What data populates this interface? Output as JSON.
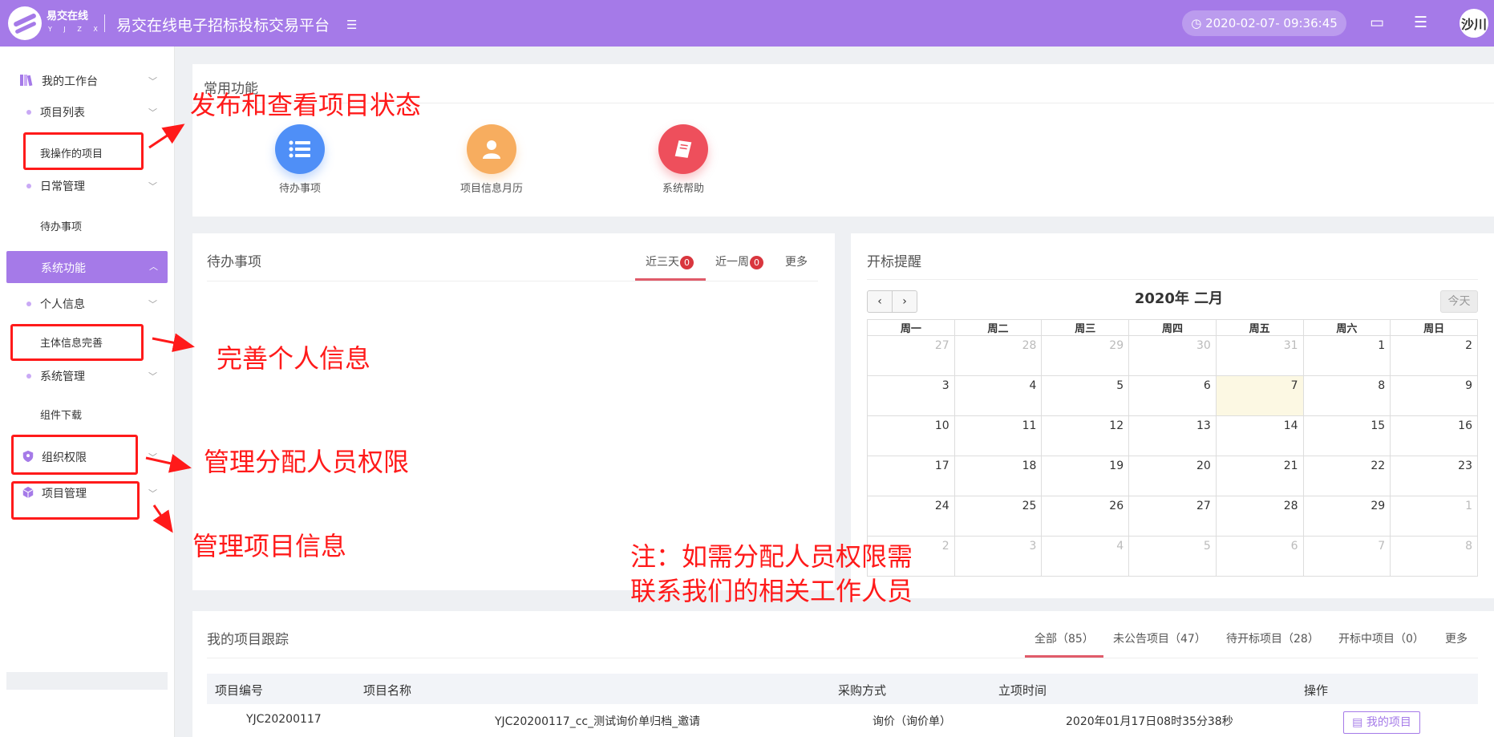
{
  "header": {
    "logo_text": "易交在线",
    "logo_sub": "Y J Z X",
    "title": "易交在线电子招标投标交易平台",
    "datetime": "2020-02-07- 09:36:45",
    "avatar_text": "沙川"
  },
  "sidebar": {
    "items": [
      {
        "label": "我的工作台"
      },
      {
        "label": "项目列表"
      },
      {
        "label": "我操作的项目"
      },
      {
        "label": "日常管理"
      },
      {
        "label": "待办事项"
      },
      {
        "label": "系统功能"
      },
      {
        "label": "个人信息"
      },
      {
        "label": "主体信息完善"
      },
      {
        "label": "系统管理"
      },
      {
        "label": "组件下载"
      },
      {
        "label": "组织权限"
      },
      {
        "label": "项目管理"
      }
    ]
  },
  "quick": {
    "title": "常用功能",
    "items": [
      {
        "label": "待办事项",
        "color": "#4f8ff7"
      },
      {
        "label": "项目信息月历",
        "color": "#f7ad5f"
      },
      {
        "label": "系统帮助",
        "color": "#ee4f5c"
      }
    ]
  },
  "todo": {
    "title": "待办事项",
    "tabs": [
      {
        "label": "近三天",
        "count": "0"
      },
      {
        "label": "近一周",
        "count": "0"
      },
      {
        "label": "更多"
      }
    ]
  },
  "calendar": {
    "title": "开标提醒",
    "month_title": "2020年 二月",
    "prev": "‹",
    "next": "›",
    "today_label": "今天",
    "weekdays": [
      "周一",
      "周二",
      "周三",
      "周四",
      "周五",
      "周六",
      "周日"
    ],
    "weeks": [
      [
        "27",
        "28",
        "29",
        "30",
        "31",
        "1",
        "2"
      ],
      [
        "3",
        "4",
        "5",
        "6",
        "7",
        "8",
        "9"
      ],
      [
        "10",
        "11",
        "12",
        "13",
        "14",
        "15",
        "16"
      ],
      [
        "17",
        "18",
        "19",
        "20",
        "21",
        "22",
        "23"
      ],
      [
        "24",
        "25",
        "26",
        "27",
        "28",
        "29",
        "1"
      ],
      [
        "2",
        "3",
        "4",
        "5",
        "6",
        "7",
        "8"
      ]
    ],
    "today": "7"
  },
  "projects": {
    "title": "我的项目跟踪",
    "tabs": [
      {
        "label": "全部（85）"
      },
      {
        "label": "未公告项目（47）"
      },
      {
        "label": "待开标项目（28）"
      },
      {
        "label": "开标中项目（0）"
      },
      {
        "label": "更多"
      }
    ],
    "columns": [
      "项目编号",
      "项目名称",
      "采购方式",
      "立项时间",
      "操作"
    ],
    "rows": [
      {
        "code": "YJC20200117",
        "name": "YJC20200117_cc_测试询价单归档_邀请",
        "method": "询价（询价单）",
        "time": "2020年01月17日08时35分38秒",
        "action": "我的项目"
      }
    ]
  },
  "annotations": {
    "publish": "发布和查看项目状态",
    "personal": "完善个人信息",
    "permission": "管理分配人员权限",
    "project": "管理项目信息",
    "note_line1": "注：如需分配人员权限需",
    "note_line2": "联系我们的相关工作人员"
  }
}
